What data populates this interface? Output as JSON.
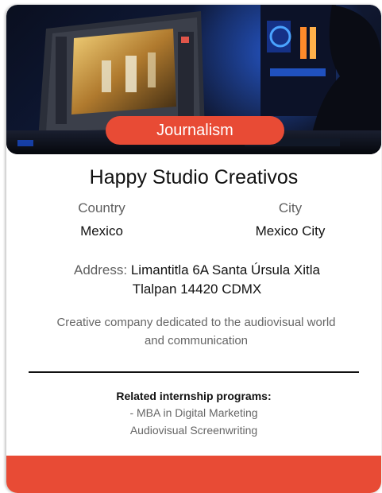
{
  "card": {
    "category": "Journalism",
    "title": "Happy Studio Creativos",
    "country_label": "Country",
    "country_value": "Mexico",
    "city_label": "City",
    "city_value": "Mexico City",
    "address_label": "Address:",
    "address_value": "Limantitla 6A Santa Úrsula Xitla Tlalpan 14420 CDMX",
    "description": "Creative company dedicated to the audiovisual world and communication",
    "related_title": "Related internship programs:",
    "related_items": [
      "- MBA in Digital Marketing",
      "Audiovisual Screenwriting"
    ]
  },
  "colors": {
    "accent": "#e84b35",
    "text_primary": "#111111",
    "text_secondary": "#666666"
  }
}
